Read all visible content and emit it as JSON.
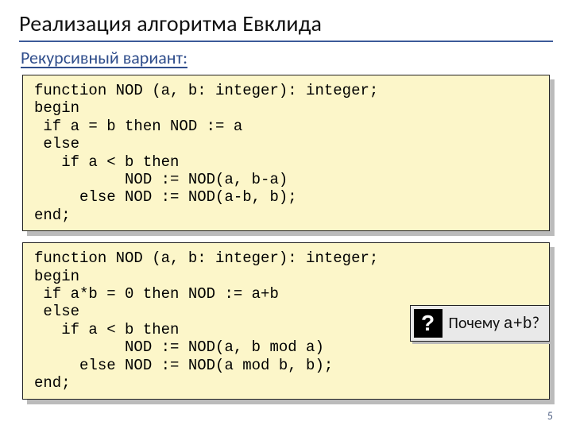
{
  "slide": {
    "title": "Реализация алгоритма Евклида",
    "subtitle": "Рекурсивный вариант:",
    "page_number": "5"
  },
  "code_block_1": "function NOD (a, b: integer): integer;\nbegin\n if a = b then NOD := a\n else\n   if a < b then\n          NOD := NOD(a, b-a)\n     else NOD := NOD(a-b, b);\nend;",
  "code_block_2": "function NOD (a, b: integer): integer;\nbegin\n if a*b = 0 then NOD := a+b\n else\n   if a < b then\n          NOD := NOD(a, b mod a)\n     else NOD := NOD(a mod b, b);\nend;",
  "callout": {
    "icon": "?",
    "text_prefix": "Почему ",
    "code": "a+b",
    "text_suffix": "?"
  }
}
